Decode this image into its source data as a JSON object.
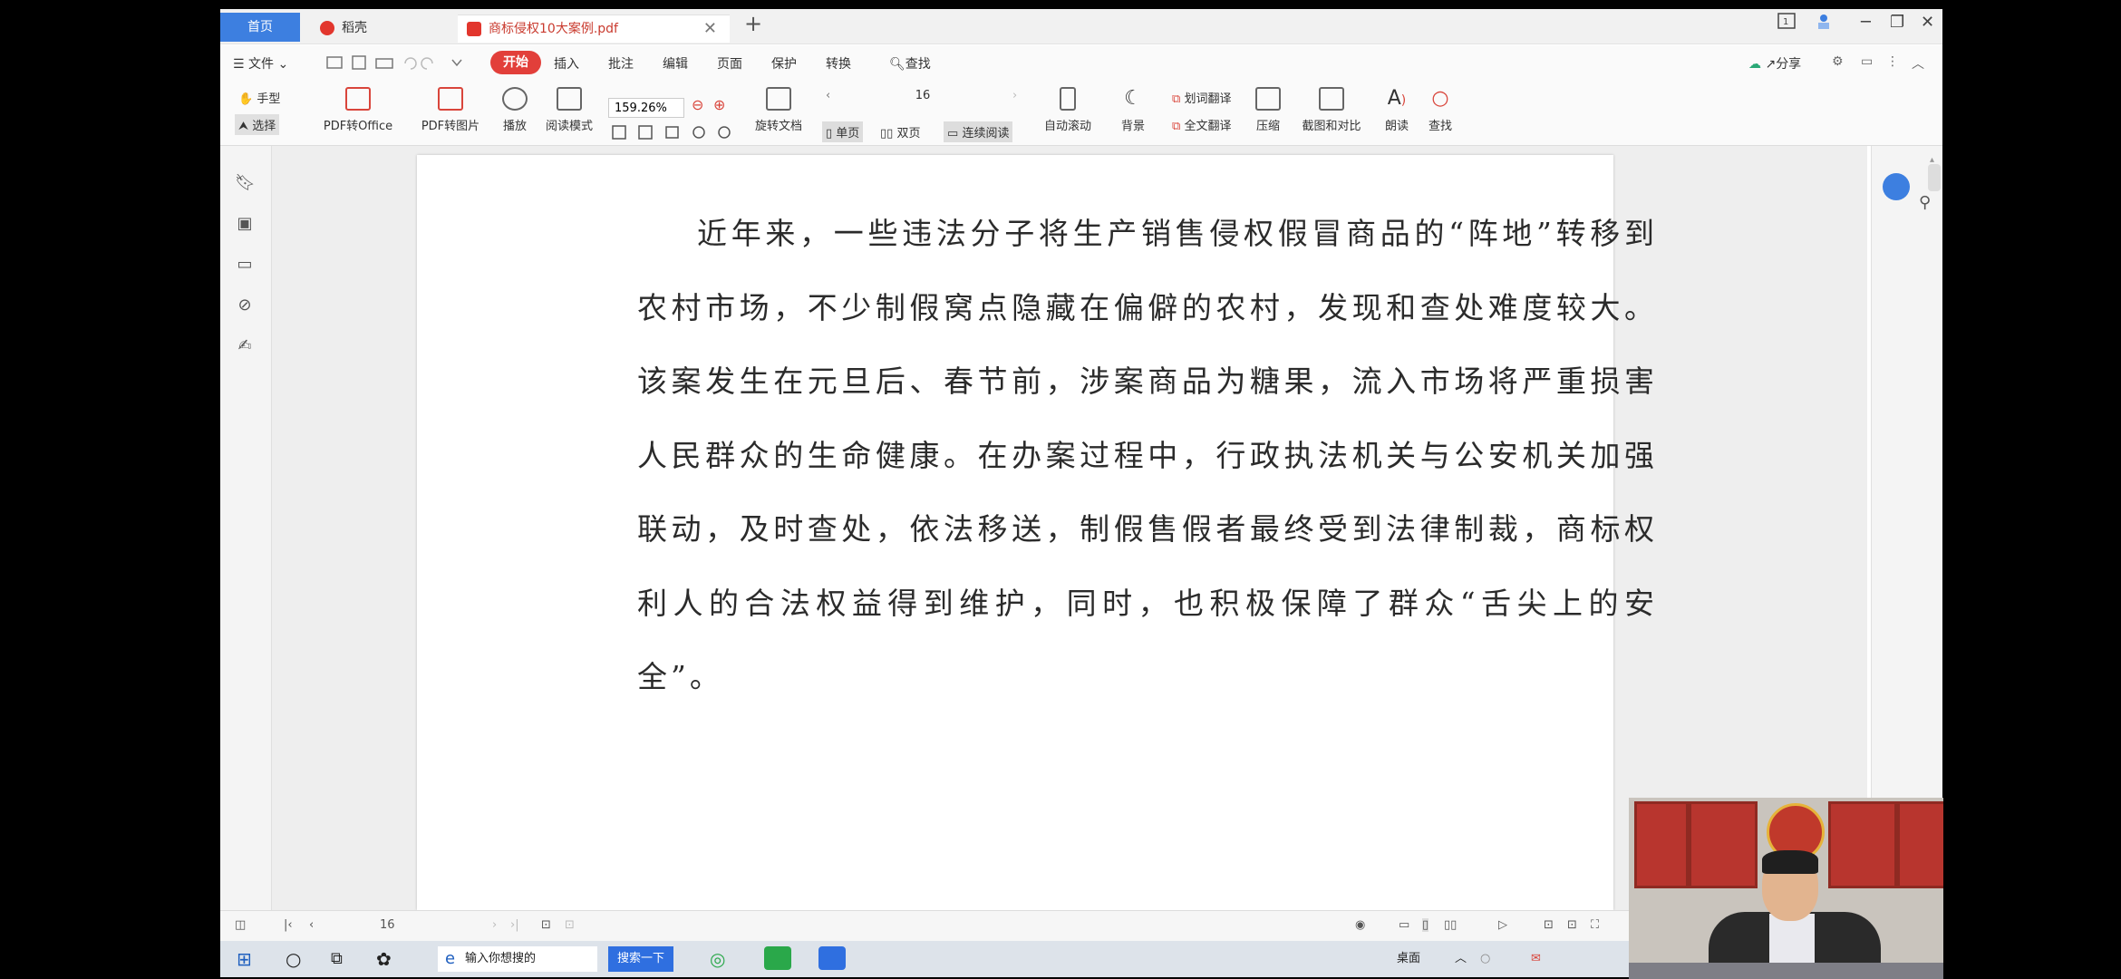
{
  "tabs": {
    "home": "首页",
    "shell": "稻壳",
    "pdf": "商标侵权10大案例.pdf",
    "add": "+",
    "close": "✕"
  },
  "window_controls": {
    "minimize": "─",
    "restore": "❐",
    "close": "✕"
  },
  "menu": {
    "file": "文件",
    "start": "开始",
    "insert": "插入",
    "comment": "批注",
    "edit": "编辑",
    "page": "页面",
    "protect": "保护",
    "convert": "转换",
    "search": "查找",
    "share": "分享"
  },
  "toolbar": {
    "hand": "手型",
    "select": "选择",
    "pdf_to_office": "PDF转Office",
    "pdf_to_image": "PDF转图片",
    "play": "播放",
    "read_mode": "阅读模式",
    "zoom": "159.26%",
    "rotate": "旋转文档",
    "page_num": "16",
    "single": "单页",
    "double": "双页",
    "continuous": "连续阅读",
    "auto_scroll": "自动滚动",
    "background": "背景",
    "word_translate": "划词翻译",
    "full_translate": "全文翻译",
    "compress": "压缩",
    "screenshot_compare": "截图和对比",
    "read_aloud": "朗读",
    "find": "查找"
  },
  "document": {
    "paragraph": "近年来，一些违法分子将生产销售侵权假冒商品的“阵地”转移到农村市场，不少制假窝点隐藏在偏僻的农村，发现和查处难度较大。该案发生在元旦后、春节前，涉案商品为糖果，流入市场将严重损害人民群众的生命健康。在办案过程中，行政执法机关与公安机关加强联动，及时查处，依法移送，制假售假者最终受到法律制裁，商标权利人的合法权益得到维护，同时，也积极保障了群众“舌尖上的安全”。"
  },
  "statusbar": {
    "page": "16"
  },
  "taskbar": {
    "search_placeholder": "输入你想搜的",
    "search_button": "搜索一下",
    "desktop": "桌面"
  },
  "colors": {
    "accent": "#e23f3a",
    "home_tab": "#3d7fe0"
  }
}
